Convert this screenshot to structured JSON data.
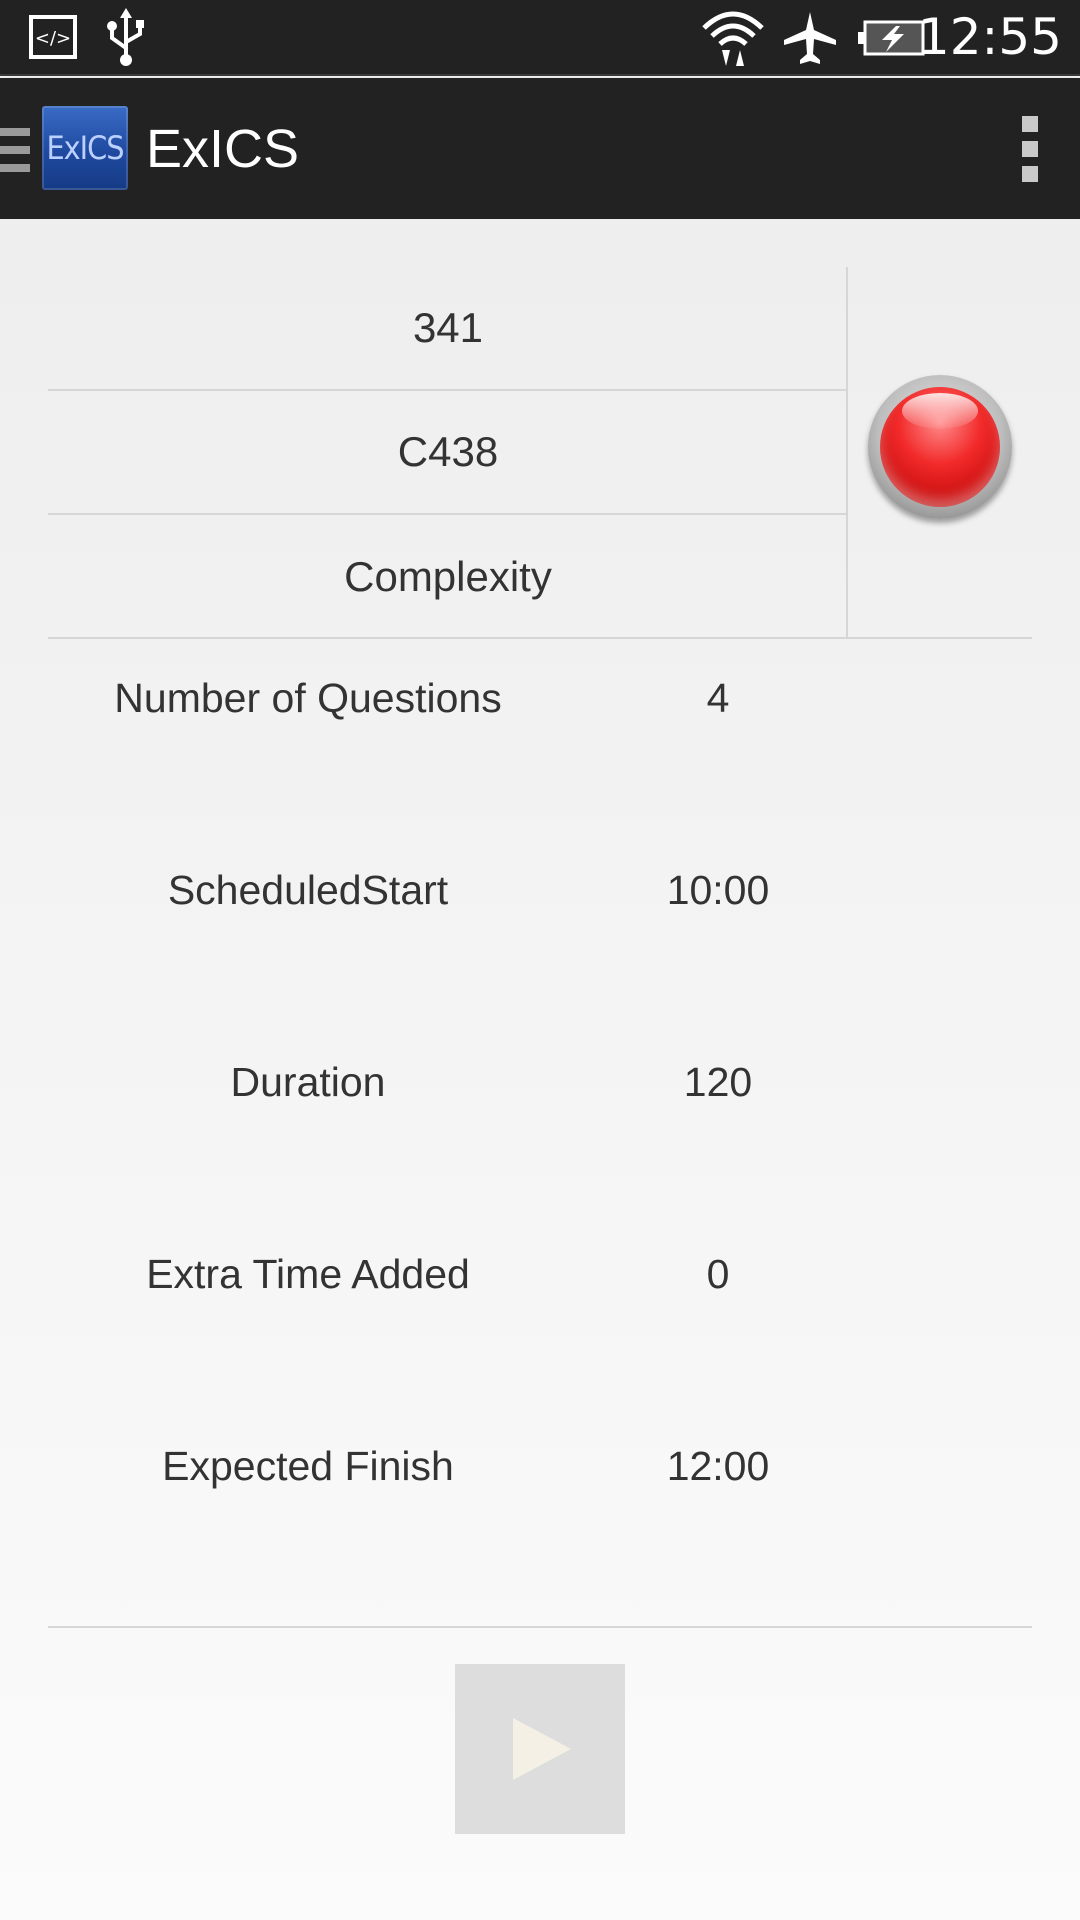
{
  "status_bar": {
    "clock": "12:55",
    "icons": [
      "developer-code-icon",
      "usb-icon",
      "wifi-icon",
      "airplane-mode-icon",
      "battery-charging-icon"
    ]
  },
  "action_bar": {
    "logo_text": "ExICS",
    "title": "ExICS",
    "menu_icon": "overflow-menu-icon"
  },
  "exam_header": {
    "row1": "341",
    "row2": "C438",
    "row3": "Complexity",
    "status_icon": "record-red-icon",
    "status_color": "#e61c1c"
  },
  "details": [
    {
      "label": "Number of Questions",
      "value": "4"
    },
    {
      "label": "ScheduledStart",
      "value": "10:00"
    },
    {
      "label": "Duration",
      "value": "120"
    },
    {
      "label": "Extra Time Added",
      "value": "0"
    },
    {
      "label": "Expected Finish",
      "value": "12:00"
    }
  ],
  "controls": {
    "play_icon": "play-icon"
  }
}
